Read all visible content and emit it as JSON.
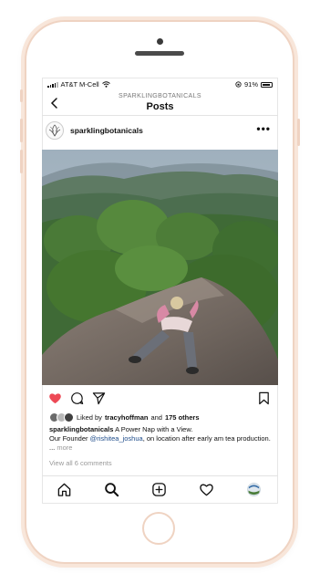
{
  "status_bar": {
    "carrier": "AT&T M-Cell",
    "battery_percent": "91%",
    "battery_level": 0.91
  },
  "header": {
    "subtitle": "SPARKLINGBOTANICALS",
    "title": "Posts"
  },
  "post": {
    "username": "sparklingbotanicals",
    "more_icon": "•••",
    "liked_by_prefix": "Liked by",
    "liked_by_user": "tracyhoffman",
    "liked_by_and": "and",
    "liked_by_others": "175 others",
    "caption_user": "sparklingbotanicals",
    "caption_text": "A Power Nap with a View.",
    "caption_line2_prefix": "Our Founder",
    "caption_mention": "@rishitea_joshua",
    "caption_line2_suffix": ", on location after early am tea production. ...",
    "caption_more": "more",
    "view_all_comments": "View all 6 comments",
    "liked": true
  },
  "icons": {
    "back": "chevron-left-icon",
    "like": "heart-icon",
    "comment": "comment-icon",
    "share": "send-icon",
    "save": "bookmark-icon",
    "home": "home-icon",
    "search": "search-icon",
    "add": "add-post-icon",
    "activity": "heart-outline-icon",
    "profile": "profile-avatar-icon"
  },
  "colors": {
    "like_red": "#ed4956",
    "mention_blue": "#1e4c8a",
    "phone_frame": "#efd3c2"
  }
}
